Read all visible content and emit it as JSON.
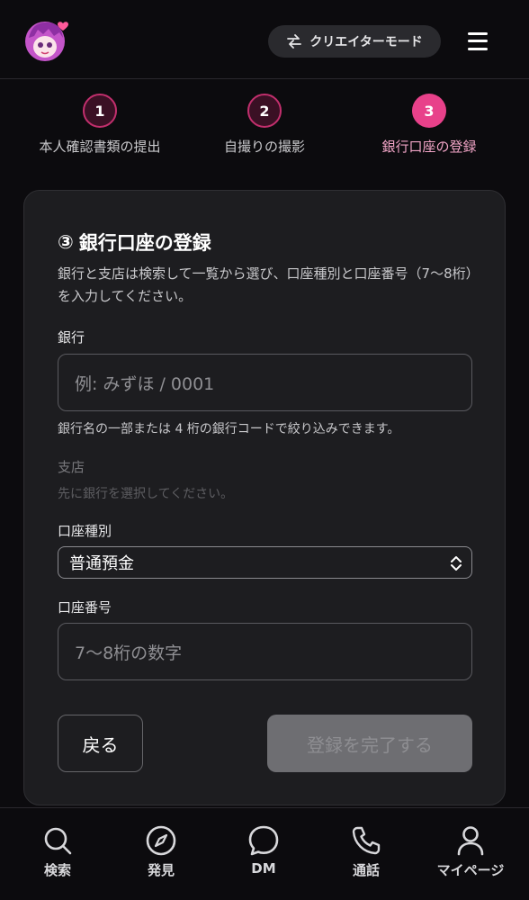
{
  "header": {
    "mode_label": "クリエイターモード",
    "mode_icon": "swap-arrows-icon",
    "menu_icon": "hamburger-icon",
    "avatar_icon": "anime-avatar-icon"
  },
  "steps": [
    {
      "number": "1",
      "label": "本人確認書類の提出",
      "state": "done"
    },
    {
      "number": "2",
      "label": "自撮りの撮影",
      "state": "done"
    },
    {
      "number": "3",
      "label": "銀行口座の登録",
      "state": "active"
    }
  ],
  "form": {
    "title_number": "③",
    "title": "銀行口座の登録",
    "description": "銀行と支店は検索して一覧から選び、口座種別と口座番号（7〜8桁）を入力してください。",
    "bank_label": "銀行",
    "bank_placeholder": "例: みずほ / 0001",
    "bank_hint": "銀行名の一部または 4 桁の銀行コードで絞り込みできます。",
    "branch_label": "支店",
    "branch_hint": "先に銀行を選択してください。",
    "account_type_label": "口座種別",
    "account_type_value": "普通預金",
    "account_number_label": "口座番号",
    "account_number_placeholder": "7〜8桁の数字",
    "back_label": "戻る",
    "submit_label": "登録を完了する"
  },
  "tabs": [
    {
      "label": "検索",
      "icon": "search-icon"
    },
    {
      "label": "発見",
      "icon": "compass-icon"
    },
    {
      "label": "DM",
      "icon": "chat-bubble-icon"
    },
    {
      "label": "通話",
      "icon": "phone-icon"
    },
    {
      "label": "マイページ",
      "icon": "user-icon"
    }
  ],
  "colors": {
    "accent": "#e8418a",
    "background": "#0c0b0e",
    "card": "#1d1d20"
  }
}
